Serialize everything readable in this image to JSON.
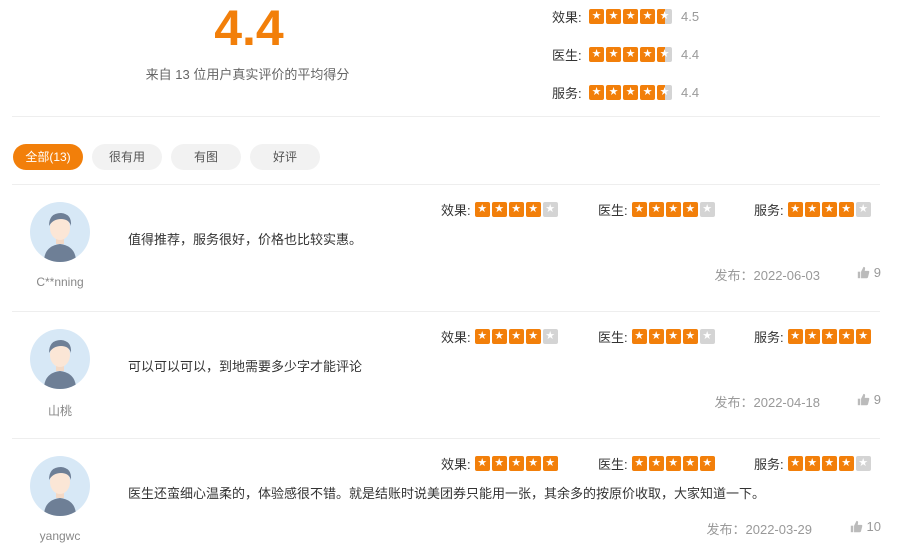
{
  "summary": {
    "average": "4.4",
    "caption": "来自 13 位用户真实评价的平均得分",
    "dimensions": [
      {
        "label": "效果:",
        "value": "4.5",
        "stars": 4.5
      },
      {
        "label": "医生:",
        "value": "4.4",
        "stars": 4.4
      },
      {
        "label": "服务:",
        "value": "4.4",
        "stars": 4.4
      }
    ]
  },
  "filters": [
    {
      "label": "全部(13)",
      "active": true
    },
    {
      "label": "很有用",
      "active": false
    },
    {
      "label": "有图",
      "active": false
    },
    {
      "label": "好评",
      "active": false
    }
  ],
  "colors": {
    "accent": "#f27f0a",
    "star_empty": "#d4d4d4"
  },
  "icons": {
    "like": "thumbs-up-icon",
    "star": "star-icon",
    "avatar": "default-user-avatar"
  },
  "reviews": [
    {
      "username": "C**nning",
      "ratings": [
        {
          "label": "效果:",
          "stars": 4
        },
        {
          "label": "医生:",
          "stars": 4
        },
        {
          "label": "服务:",
          "stars": 4
        }
      ],
      "text": "值得推荐，服务很好，价格也比较实惠。",
      "date": "发布：2022-06-03",
      "likes": "9"
    },
    {
      "username": "山桃",
      "ratings": [
        {
          "label": "效果:",
          "stars": 4
        },
        {
          "label": "医生:",
          "stars": 4
        },
        {
          "label": "服务:",
          "stars": 5
        }
      ],
      "text": "可以可以可以，到地需要多少字才能评论",
      "date": "发布：2022-04-18",
      "likes": "9"
    },
    {
      "username": "yangwc",
      "ratings": [
        {
          "label": "效果:",
          "stars": 5
        },
        {
          "label": "医生:",
          "stars": 5
        },
        {
          "label": "服务:",
          "stars": 4
        }
      ],
      "text": "医生还蛮细心温柔的，体验感很不错。就是结账时说美团券只能用一张，其余多的按原价收取，大家知道一下。",
      "date": "发布：2022-03-29",
      "likes": "10"
    }
  ]
}
